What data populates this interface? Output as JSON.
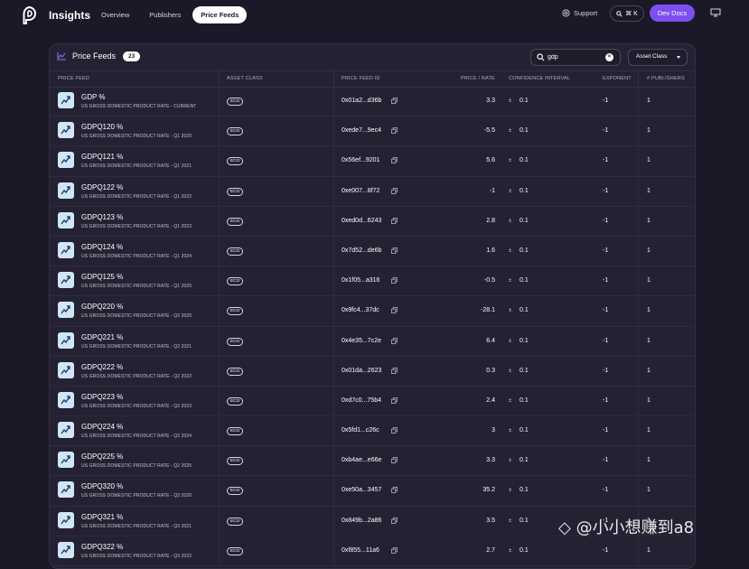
{
  "header": {
    "app_title": "Insights",
    "nav": [
      {
        "label": "Overview",
        "active": false
      },
      {
        "label": "Publishers",
        "active": false
      },
      {
        "label": "Price Feeds",
        "active": true
      }
    ],
    "support_label": "Support",
    "shortcut_label": "⌘ K",
    "dev_docs_label": "Dev Docs",
    "accent_color": "#7c4ff0"
  },
  "card": {
    "title": "Price Feeds",
    "count": "23",
    "search": {
      "value": "gdp",
      "placeholder": ""
    },
    "asset_class_label": "Asset Class"
  },
  "table": {
    "columns": [
      "PRICE FEED",
      "ASSET CLASS",
      "PRICE FEED ID",
      "PRICE / RATE",
      "CONFIDENCE INTERVAL",
      "EXPONENT",
      "# PUBLISHERS"
    ],
    "rows": [
      {
        "symbol": "GDP %",
        "desc": "US GROSS DOMESTIC PRODUCT RATE - CURRENT",
        "asset_class": "ECO",
        "id": "0x01a2...d36b",
        "price": "3.3",
        "conf": "0.1",
        "exponent": "-1",
        "publishers": "1"
      },
      {
        "symbol": "GDPQ120 %",
        "desc": "US GROSS DOMESTIC PRODUCT RATE - Q1 2020",
        "asset_class": "ECO",
        "id": "0xede7...9ec4",
        "price": "-5.5",
        "conf": "0.1",
        "exponent": "-1",
        "publishers": "1"
      },
      {
        "symbol": "GDPQ121 %",
        "desc": "US GROSS DOMESTIC PRODUCT RATE - Q1 2021",
        "asset_class": "ECO",
        "id": "0x56ef...9201",
        "price": "5.6",
        "conf": "0.1",
        "exponent": "-1",
        "publishers": "1"
      },
      {
        "symbol": "GDPQ122 %",
        "desc": "US GROSS DOMESTIC PRODUCT RATE - Q1 2022",
        "asset_class": "ECO",
        "id": "0xe007...8f72",
        "price": "-1",
        "conf": "0.1",
        "exponent": "-1",
        "publishers": "1"
      },
      {
        "symbol": "GDPQ123 %",
        "desc": "US GROSS DOMESTIC PRODUCT RATE - Q1 2023",
        "asset_class": "ECO",
        "id": "0xed0d...6243",
        "price": "2.8",
        "conf": "0.1",
        "exponent": "-1",
        "publishers": "1"
      },
      {
        "symbol": "GDPQ124 %",
        "desc": "US GROSS DOMESTIC PRODUCT RATE - Q1 2024",
        "asset_class": "ECO",
        "id": "0x7d52...de6b",
        "price": "1.6",
        "conf": "0.1",
        "exponent": "-1",
        "publishers": "1"
      },
      {
        "symbol": "GDPQ125 %",
        "desc": "US GROSS DOMESTIC PRODUCT RATE - Q1 2025",
        "asset_class": "ECO",
        "id": "0x1f05...a316",
        "price": "-0.5",
        "conf": "0.1",
        "exponent": "-1",
        "publishers": "1"
      },
      {
        "symbol": "GDPQ220 %",
        "desc": "US GROSS DOMESTIC PRODUCT RATE - Q2 2020",
        "asset_class": "ECO",
        "id": "0x9fc4...37dc",
        "price": "-28.1",
        "conf": "0.1",
        "exponent": "-1",
        "publishers": "1"
      },
      {
        "symbol": "GDPQ221 %",
        "desc": "US GROSS DOMESTIC PRODUCT RATE - Q2 2021",
        "asset_class": "ECO",
        "id": "0x4e35...7c2e",
        "price": "6.4",
        "conf": "0.1",
        "exponent": "-1",
        "publishers": "1"
      },
      {
        "symbol": "GDPQ222 %",
        "desc": "US GROSS DOMESTIC PRODUCT RATE - Q2 2022",
        "asset_class": "ECO",
        "id": "0x01da...2623",
        "price": "0.3",
        "conf": "0.1",
        "exponent": "-1",
        "publishers": "1"
      },
      {
        "symbol": "GDPQ223 %",
        "desc": "US GROSS DOMESTIC PRODUCT RATE - Q2 2023",
        "asset_class": "ECO",
        "id": "0xd7c0...75b4",
        "price": "2.4",
        "conf": "0.1",
        "exponent": "-1",
        "publishers": "1"
      },
      {
        "symbol": "GDPQ224 %",
        "desc": "US GROSS DOMESTIC PRODUCT RATE - Q2 2024",
        "asset_class": "ECO",
        "id": "0x5fd1...c26c",
        "price": "3",
        "conf": "0.1",
        "exponent": "-1",
        "publishers": "1"
      },
      {
        "symbol": "GDPQ225 %",
        "desc": "US GROSS DOMESTIC PRODUCT RATE - Q2 2025",
        "asset_class": "ECO",
        "id": "0xb4ae...e66e",
        "price": "3.3",
        "conf": "0.1",
        "exponent": "-1",
        "publishers": "1"
      },
      {
        "symbol": "GDPQ320 %",
        "desc": "US GROSS DOMESTIC PRODUCT RATE - Q3 2020",
        "asset_class": "ECO",
        "id": "0xe50a...3457",
        "price": "35.2",
        "conf": "0.1",
        "exponent": "-1",
        "publishers": "1"
      },
      {
        "symbol": "GDPQ321 %",
        "desc": "US GROSS DOMESTIC PRODUCT RATE - Q3 2021",
        "asset_class": "ECO",
        "id": "0x849b...2a86",
        "price": "3.5",
        "conf": "0.1",
        "exponent": "-1",
        "publishers": "1"
      },
      {
        "symbol": "GDPQ322 %",
        "desc": "US GROSS DOMESTIC PRODUCT RATE - Q3 2022",
        "asset_class": "ECO",
        "id": "0xf855...11a6",
        "price": "2.7",
        "conf": "0.1",
        "exponent": "-1",
        "publishers": "1"
      }
    ]
  },
  "watermark": "◇ @小小想赚到a8"
}
